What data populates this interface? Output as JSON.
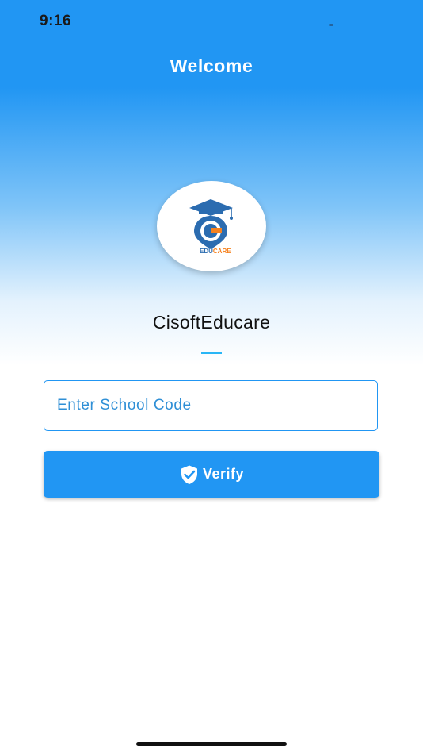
{
  "status_bar": {
    "time": "9:16"
  },
  "header": {
    "title": "Welcome"
  },
  "logo": {
    "text_part1": "EDU",
    "text_part2": "CARE",
    "colors": {
      "primary_blue": "#2b6cb0",
      "accent_orange": "#f58220"
    }
  },
  "app": {
    "name": "CisoftEducare"
  },
  "form": {
    "school_code": {
      "value": "",
      "placeholder": "Enter School Code"
    },
    "verify_label": "Verify",
    "verify_icon": "shield-check-icon"
  },
  "colors": {
    "accent": "#2196f3",
    "divider": "#29b6f6"
  }
}
